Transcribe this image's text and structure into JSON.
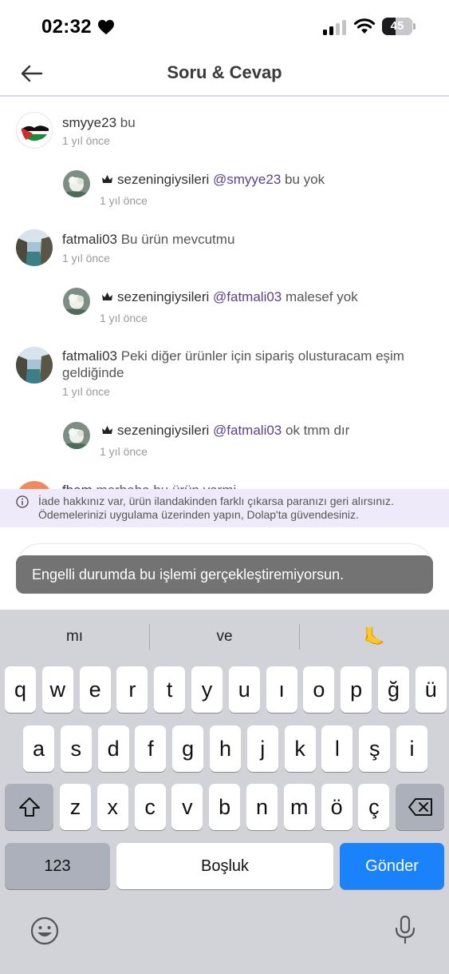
{
  "status_bar": {
    "time": "02:32",
    "battery": "45",
    "battery_level": 0.45
  },
  "header": {
    "title": "Soru & Cevap"
  },
  "comments": [
    {
      "user": "smyye23",
      "text": "bu",
      "time": "1 yıl önce",
      "mention": ""
    },
    {
      "user": "sezeningiysileri",
      "mention": "@smyye23",
      "text": "bu yok",
      "time": "1 yıl önce"
    },
    {
      "user": "fatmali03",
      "text": "Bu ürün mevcutmu",
      "time": "1 yıl önce",
      "mention": ""
    },
    {
      "user": "sezeningiysileri",
      "mention": "@fatmali03",
      "text": "malesef yok",
      "time": "1 yıl önce"
    },
    {
      "user": "fatmali03",
      "text": "Peki diğer ürünler için sipariş olusturacam eşim geldiğinde",
      "time": "1 yıl önce",
      "mention": ""
    },
    {
      "user": "sezeningiysileri",
      "mention": "@fatmali03",
      "text": "ok tmm dır",
      "time": "1 yıl önce"
    },
    {
      "user": "fbem",
      "text": "merhaba bu ürün varmi",
      "time": "",
      "mention": ""
    }
  ],
  "info_banner": {
    "text": "İade hakkınız var, ürün ilandakinden farklı çıkarsa paranızı geri alırsınız. Ödemelerinizi uygulama üzerinden yapın, Dolap'ta güvendesiniz."
  },
  "toast": {
    "text": "Engelli durumda bu işlemi gerçekleştiremiyorsun."
  },
  "keyboard": {
    "suggestions": [
      "mı",
      "ve",
      "🦶"
    ],
    "row1": [
      "q",
      "w",
      "e",
      "r",
      "t",
      "y",
      "u",
      "ı",
      "o",
      "p",
      "ğ",
      "ü"
    ],
    "row2": [
      "a",
      "s",
      "d",
      "f",
      "g",
      "h",
      "j",
      "k",
      "l",
      "ş",
      "i"
    ],
    "row3": [
      "z",
      "x",
      "c",
      "v",
      "b",
      "n",
      "m",
      "ö",
      "ç"
    ],
    "numbers_key": "123",
    "space_key": "Boşluk",
    "send_key": "Gönder",
    "icons": {
      "shift": "shift-icon",
      "delete": "backspace-icon",
      "emoji": "emoji-icon",
      "dictation": "microphone-icon"
    }
  }
}
